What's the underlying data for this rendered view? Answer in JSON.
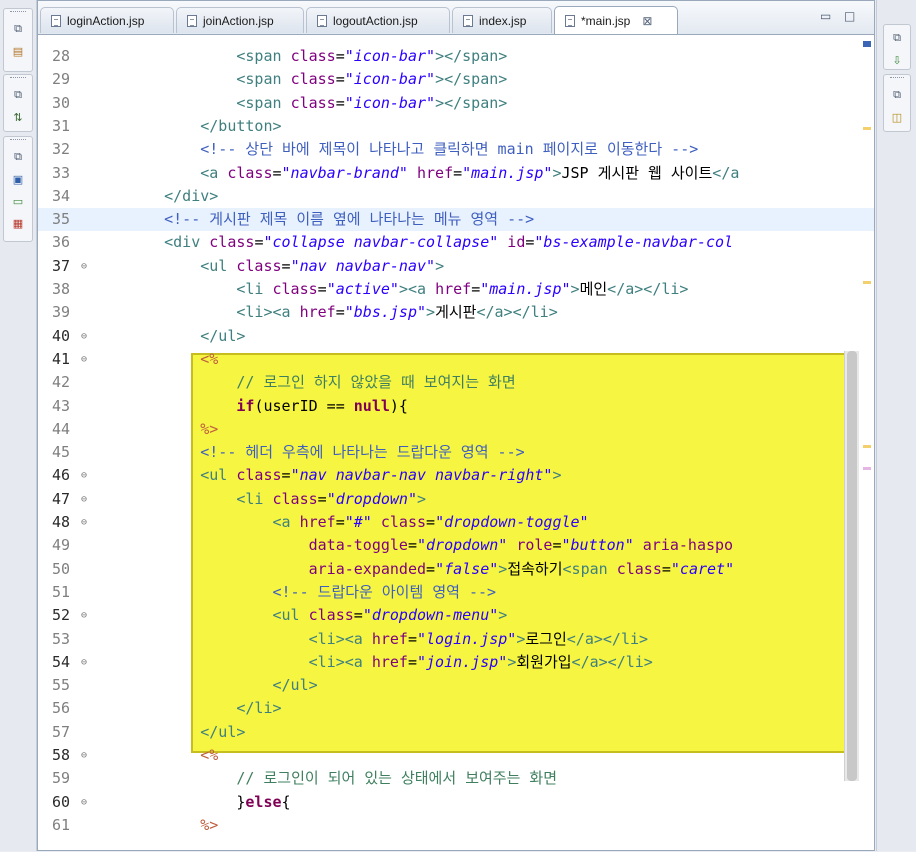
{
  "tabs": [
    {
      "label": "loginAction.jsp",
      "active": false
    },
    {
      "label": "joinAction.jsp",
      "active": false
    },
    {
      "label": "logoutAction.jsp",
      "active": false
    },
    {
      "label": "index.jsp",
      "active": false
    },
    {
      "label": "*main.jsp",
      "active": true
    }
  ],
  "editor": {
    "lines": [
      {
        "n": "28",
        "fold": false
      },
      {
        "n": "29",
        "fold": false
      },
      {
        "n": "30",
        "fold": false
      },
      {
        "n": "31",
        "fold": false
      },
      {
        "n": "32",
        "fold": false
      },
      {
        "n": "33",
        "fold": false
      },
      {
        "n": "34",
        "fold": false
      },
      {
        "n": "35",
        "fold": false
      },
      {
        "n": "36",
        "fold": false
      },
      {
        "n": "37",
        "fold": true
      },
      {
        "n": "38",
        "fold": false
      },
      {
        "n": "39",
        "fold": false
      },
      {
        "n": "40",
        "fold": true
      },
      {
        "n": "41",
        "fold": true
      },
      {
        "n": "42",
        "fold": false
      },
      {
        "n": "43",
        "fold": false
      },
      {
        "n": "44",
        "fold": false
      },
      {
        "n": "45",
        "fold": false
      },
      {
        "n": "46",
        "fold": true
      },
      {
        "n": "47",
        "fold": true
      },
      {
        "n": "48",
        "fold": true
      },
      {
        "n": "49",
        "fold": false
      },
      {
        "n": "50",
        "fold": false
      },
      {
        "n": "51",
        "fold": false
      },
      {
        "n": "52",
        "fold": true
      },
      {
        "n": "53",
        "fold": false
      },
      {
        "n": "54",
        "fold": true
      },
      {
        "n": "55",
        "fold": false
      },
      {
        "n": "56",
        "fold": false
      },
      {
        "n": "57",
        "fold": false
      },
      {
        "n": "58",
        "fold": true
      },
      {
        "n": "59",
        "fold": false
      },
      {
        "n": "60",
        "fold": true
      },
      {
        "n": "61",
        "fold": false
      }
    ],
    "code": [
      [
        {
          "t": "            ",
          "c": "plain"
        },
        {
          "t": "<span ",
          "c": "tag"
        },
        {
          "t": "class",
          "c": "attr"
        },
        {
          "t": "=",
          "c": "plain"
        },
        {
          "t": "\"icon-bar\"",
          "c": "str"
        },
        {
          "t": "></span>",
          "c": "tag"
        }
      ],
      [
        {
          "t": "            ",
          "c": "plain"
        },
        {
          "t": "<span ",
          "c": "tag"
        },
        {
          "t": "class",
          "c": "attr"
        },
        {
          "t": "=",
          "c": "plain"
        },
        {
          "t": "\"icon-bar\"",
          "c": "str"
        },
        {
          "t": "></span>",
          "c": "tag"
        }
      ],
      [
        {
          "t": "            ",
          "c": "plain"
        },
        {
          "t": "<span ",
          "c": "tag"
        },
        {
          "t": "class",
          "c": "attr"
        },
        {
          "t": "=",
          "c": "plain"
        },
        {
          "t": "\"icon-bar\"",
          "c": "str"
        },
        {
          "t": "></span>",
          "c": "tag"
        }
      ],
      [
        {
          "t": "        ",
          "c": "plain"
        },
        {
          "t": "</button>",
          "c": "tag"
        }
      ],
      [
        {
          "t": "        ",
          "c": "plain"
        },
        {
          "t": "<!-- 상단 바에 제목이 나타나고 클릭하면 main 페이지로 이동한다 -->",
          "c": "cm"
        }
      ],
      [
        {
          "t": "        ",
          "c": "plain"
        },
        {
          "t": "<a ",
          "c": "tag"
        },
        {
          "t": "class",
          "c": "attr"
        },
        {
          "t": "=",
          "c": "plain"
        },
        {
          "t": "\"navbar-brand\"",
          "c": "str"
        },
        {
          "t": " href",
          "c": "attr"
        },
        {
          "t": "=",
          "c": "plain"
        },
        {
          "t": "\"main.jsp\"",
          "c": "str"
        },
        {
          "t": ">",
          "c": "tag"
        },
        {
          "t": "JSP 게시판 웹 사이트",
          "c": "plain"
        },
        {
          "t": "</a",
          "c": "tag"
        }
      ],
      [
        {
          "t": "    ",
          "c": "plain"
        },
        {
          "t": "</div>",
          "c": "tag"
        }
      ],
      [
        {
          "t": "    ",
          "c": "plain"
        },
        {
          "t": "<!-- 게시판 제목 이름 옆에 나타나는 메뉴 영역 -->",
          "c": "cm"
        }
      ],
      [
        {
          "t": "    ",
          "c": "plain"
        },
        {
          "t": "<div ",
          "c": "tag"
        },
        {
          "t": "class",
          "c": "attr"
        },
        {
          "t": "=",
          "c": "plain"
        },
        {
          "t": "\"collapse navbar-collapse\"",
          "c": "str"
        },
        {
          "t": " id",
          "c": "attr"
        },
        {
          "t": "=",
          "c": "plain"
        },
        {
          "t": "\"bs-example-navbar-col",
          "c": "str"
        }
      ],
      [
        {
          "t": "        ",
          "c": "plain"
        },
        {
          "t": "<ul ",
          "c": "tag"
        },
        {
          "t": "class",
          "c": "attr"
        },
        {
          "t": "=",
          "c": "plain"
        },
        {
          "t": "\"nav navbar-nav\"",
          "c": "str"
        },
        {
          "t": ">",
          "c": "tag"
        }
      ],
      [
        {
          "t": "            ",
          "c": "plain"
        },
        {
          "t": "<li ",
          "c": "tag"
        },
        {
          "t": "class",
          "c": "attr"
        },
        {
          "t": "=",
          "c": "plain"
        },
        {
          "t": "\"active\"",
          "c": "str"
        },
        {
          "t": "><a ",
          "c": "tag"
        },
        {
          "t": "href",
          "c": "attr"
        },
        {
          "t": "=",
          "c": "plain"
        },
        {
          "t": "\"main.jsp\"",
          "c": "str"
        },
        {
          "t": ">",
          "c": "tag"
        },
        {
          "t": "메인",
          "c": "plain"
        },
        {
          "t": "</a></li>",
          "c": "tag"
        }
      ],
      [
        {
          "t": "            ",
          "c": "plain"
        },
        {
          "t": "<li><a ",
          "c": "tag"
        },
        {
          "t": "href",
          "c": "attr"
        },
        {
          "t": "=",
          "c": "plain"
        },
        {
          "t": "\"bbs.jsp\"",
          "c": "str"
        },
        {
          "t": ">",
          "c": "tag"
        },
        {
          "t": "게시판",
          "c": "plain"
        },
        {
          "t": "</a></li>",
          "c": "tag"
        }
      ],
      [
        {
          "t": "        ",
          "c": "plain"
        },
        {
          "t": "</ul>",
          "c": "tag"
        }
      ],
      [
        {
          "t": "        ",
          "c": "plain"
        },
        {
          "t": "<%",
          "c": "jsp"
        }
      ],
      [
        {
          "t": "            ",
          "c": "plain"
        },
        {
          "t": "// 로그인 하지 않았을 때 보여지는 화면",
          "c": "jcm"
        }
      ],
      [
        {
          "t": "            ",
          "c": "plain"
        },
        {
          "t": "if",
          "c": "kw"
        },
        {
          "t": "(userID == ",
          "c": "plain"
        },
        {
          "t": "null",
          "c": "kw"
        },
        {
          "t": "){",
          "c": "plain"
        }
      ],
      [
        {
          "t": "        ",
          "c": "plain"
        },
        {
          "t": "%>",
          "c": "jsp"
        }
      ],
      [
        {
          "t": "        ",
          "c": "plain"
        },
        {
          "t": "<!-- 헤더 우측에 나타나는 드랍다운 영역 -->",
          "c": "cm"
        }
      ],
      [
        {
          "t": "        ",
          "c": "plain"
        },
        {
          "t": "<ul ",
          "c": "tag"
        },
        {
          "t": "class",
          "c": "attr"
        },
        {
          "t": "=",
          "c": "plain"
        },
        {
          "t": "\"nav navbar-nav navbar-right\"",
          "c": "str"
        },
        {
          "t": ">",
          "c": "tag"
        }
      ],
      [
        {
          "t": "            ",
          "c": "plain"
        },
        {
          "t": "<li ",
          "c": "tag"
        },
        {
          "t": "class",
          "c": "attr"
        },
        {
          "t": "=",
          "c": "plain"
        },
        {
          "t": "\"dropdown\"",
          "c": "str"
        },
        {
          "t": ">",
          "c": "tag"
        }
      ],
      [
        {
          "t": "                ",
          "c": "plain"
        },
        {
          "t": "<a ",
          "c": "tag"
        },
        {
          "t": "href",
          "c": "attr"
        },
        {
          "t": "=",
          "c": "plain"
        },
        {
          "t": "\"#\"",
          "c": "str"
        },
        {
          "t": " class",
          "c": "attr"
        },
        {
          "t": "=",
          "c": "plain"
        },
        {
          "t": "\"dropdown-toggle\"",
          "c": "str"
        }
      ],
      [
        {
          "t": "                    ",
          "c": "plain"
        },
        {
          "t": "data-toggle",
          "c": "attr"
        },
        {
          "t": "=",
          "c": "plain"
        },
        {
          "t": "\"dropdown\"",
          "c": "str"
        },
        {
          "t": " role",
          "c": "attr"
        },
        {
          "t": "=",
          "c": "plain"
        },
        {
          "t": "\"button\"",
          "c": "str"
        },
        {
          "t": " aria-haspo",
          "c": "attr"
        }
      ],
      [
        {
          "t": "                    ",
          "c": "plain"
        },
        {
          "t": "aria-expanded",
          "c": "attr"
        },
        {
          "t": "=",
          "c": "plain"
        },
        {
          "t": "\"false\"",
          "c": "str"
        },
        {
          "t": ">",
          "c": "tag"
        },
        {
          "t": "접속하기",
          "c": "plain"
        },
        {
          "t": "<span ",
          "c": "tag"
        },
        {
          "t": "class",
          "c": "attr"
        },
        {
          "t": "=",
          "c": "plain"
        },
        {
          "t": "\"caret\"",
          "c": "str"
        }
      ],
      [
        {
          "t": "                ",
          "c": "plain"
        },
        {
          "t": "<!-- 드랍다운 아이템 영역 -->",
          "c": "cm"
        }
      ],
      [
        {
          "t": "                ",
          "c": "plain"
        },
        {
          "t": "<ul ",
          "c": "tag"
        },
        {
          "t": "class",
          "c": "attr"
        },
        {
          "t": "=",
          "c": "plain"
        },
        {
          "t": "\"dropdown-menu\"",
          "c": "str"
        },
        {
          "t": ">",
          "c": "tag"
        }
      ],
      [
        {
          "t": "                    ",
          "c": "plain"
        },
        {
          "t": "<li><a ",
          "c": "tag"
        },
        {
          "t": "href",
          "c": "attr"
        },
        {
          "t": "=",
          "c": "plain"
        },
        {
          "t": "\"login.jsp\"",
          "c": "str"
        },
        {
          "t": ">",
          "c": "tag"
        },
        {
          "t": "로그인",
          "c": "plain"
        },
        {
          "t": "</a></li>",
          "c": "tag"
        }
      ],
      [
        {
          "t": "                    ",
          "c": "plain"
        },
        {
          "t": "<li><a ",
          "c": "tag"
        },
        {
          "t": "href",
          "c": "attr"
        },
        {
          "t": "=",
          "c": "plain"
        },
        {
          "t": "\"join.jsp\"",
          "c": "str"
        },
        {
          "t": ">",
          "c": "tag"
        },
        {
          "t": "회원가입",
          "c": "plain"
        },
        {
          "t": "</a></li>",
          "c": "tag"
        }
      ],
      [
        {
          "t": "                ",
          "c": "plain"
        },
        {
          "t": "</ul>",
          "c": "tag"
        }
      ],
      [
        {
          "t": "            ",
          "c": "plain"
        },
        {
          "t": "</li>",
          "c": "tag"
        }
      ],
      [
        {
          "t": "        ",
          "c": "plain"
        },
        {
          "t": "</ul>",
          "c": "tag"
        }
      ],
      [
        {
          "t": "        ",
          "c": "plain"
        },
        {
          "t": "<%",
          "c": "jsp"
        }
      ],
      [
        {
          "t": "            ",
          "c": "plain"
        },
        {
          "t": "// 로그인이 되어 있는 상태에서 보여주는 화면",
          "c": "jcm"
        }
      ],
      [
        {
          "t": "            ",
          "c": "plain"
        },
        {
          "t": "}",
          "c": "plain"
        },
        {
          "t": "else",
          "c": "kw"
        },
        {
          "t": "{",
          "c": "plain"
        }
      ],
      [
        {
          "t": "        ",
          "c": "plain"
        },
        {
          "t": "%>",
          "c": "jsp"
        }
      ]
    ]
  },
  "colors": {
    "highlight": "#f5f542",
    "current_line": "#e8f2fe"
  }
}
